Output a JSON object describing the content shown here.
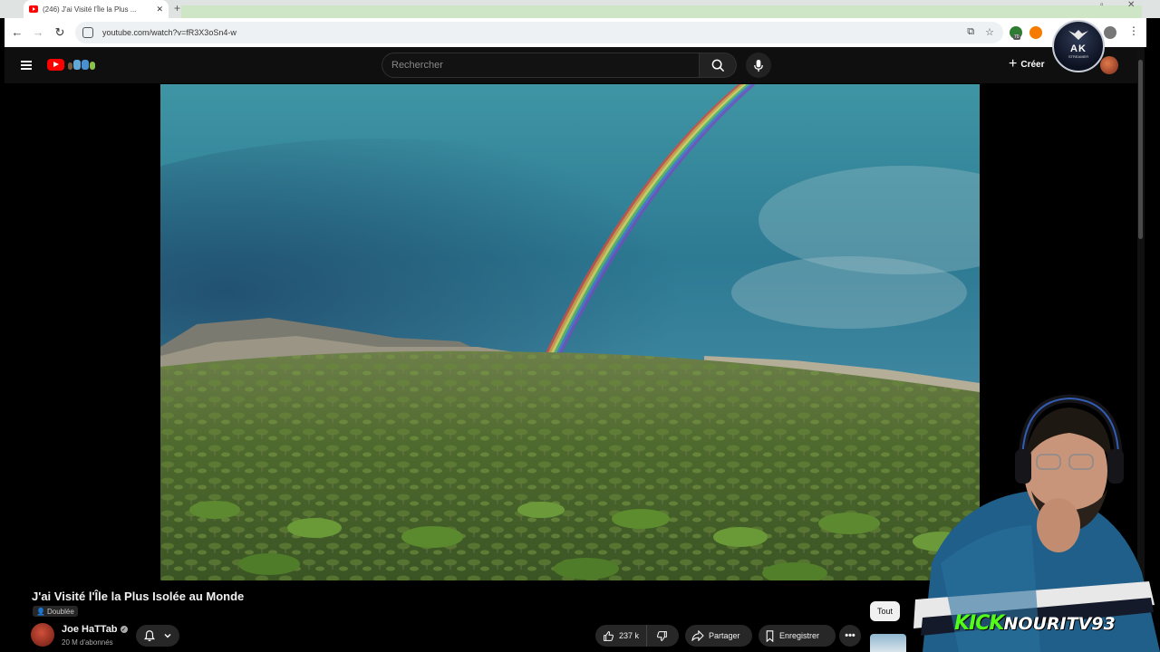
{
  "browser": {
    "tab_title": "(246) J'ai Visité l'Île la Plus ...",
    "address": "youtube.com/watch?v=fR3X3oSn4-w",
    "extension_badge": "70"
  },
  "youtube": {
    "search_placeholder": "Rechercher",
    "create_label": "Créer"
  },
  "overlay_badge": {
    "letters": "AK",
    "subtitle": "STREAMER"
  },
  "video": {
    "title": "J'ai Visité l'Île la Plus Isolée au Monde",
    "dubbed_label": "Doublée",
    "channel_name": "Joe HaTTab",
    "subscribers": "20 M d'abonnés",
    "likes": "237 k",
    "share_label": "Partager",
    "save_label": "Enregistrer",
    "more_label": "•••"
  },
  "sidebar": {
    "chip_label": "Tout"
  },
  "stream_overlay": {
    "platform": "KICK",
    "username": "NOURITV93"
  },
  "colors": {
    "yt_red": "#ff0000",
    "kick_green": "#53fc18",
    "header_bg": "#0f0f0f",
    "button_bg": "#272727"
  },
  "icons": [
    "hamburger-icon",
    "youtube-logo-icon",
    "search-icon",
    "mic-icon",
    "plus-icon",
    "bell-icon",
    "chevron-down-icon",
    "thumbs-up-icon",
    "thumbs-down-icon",
    "share-icon",
    "bookmark-icon",
    "more-icon",
    "verified-icon"
  ]
}
